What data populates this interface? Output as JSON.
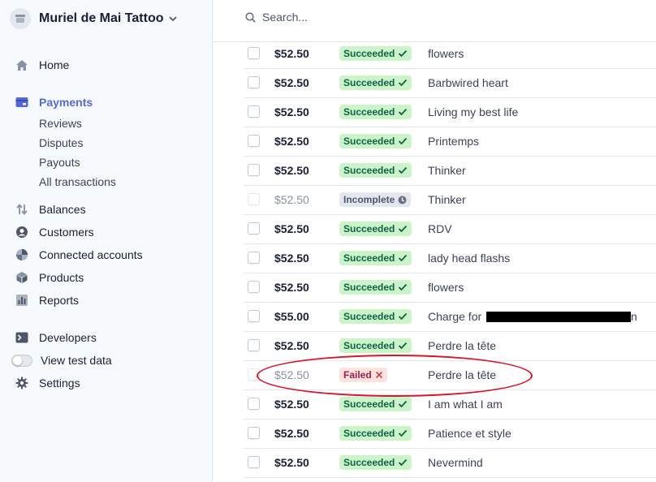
{
  "account": {
    "name": "Muriel de Mai Tattoo"
  },
  "sidebar": {
    "items": [
      {
        "key": "home",
        "label": "Home",
        "icon": "home-icon"
      },
      {
        "key": "payments",
        "label": "Payments",
        "icon": "payments-icon",
        "active": true
      },
      {
        "key": "balances",
        "label": "Balances",
        "icon": "balances-icon"
      },
      {
        "key": "customers",
        "label": "Customers",
        "icon": "customers-icon"
      },
      {
        "key": "connected",
        "label": "Connected accounts",
        "icon": "connected-accounts-icon"
      },
      {
        "key": "products",
        "label": "Products",
        "icon": "products-icon"
      },
      {
        "key": "reports",
        "label": "Reports",
        "icon": "reports-icon"
      },
      {
        "key": "developers",
        "label": "Developers",
        "icon": "terminal-icon"
      },
      {
        "key": "testdata",
        "label": "View test data",
        "icon": "toggle"
      },
      {
        "key": "settings",
        "label": "Settings",
        "icon": "gear-icon"
      }
    ],
    "payments_sub": [
      "Reviews",
      "Disputes",
      "Payouts",
      "All transactions"
    ]
  },
  "search": {
    "placeholder": "Search..."
  },
  "payments": [
    {
      "amount": "$52.50",
      "status": "Succeeded",
      "description": "flowers"
    },
    {
      "amount": "$52.50",
      "status": "Succeeded",
      "description": "Barbwired heart"
    },
    {
      "amount": "$52.50",
      "status": "Succeeded",
      "description": "Living my best life"
    },
    {
      "amount": "$52.50",
      "status": "Succeeded",
      "description": "Printemps"
    },
    {
      "amount": "$52.50",
      "status": "Succeeded",
      "description": "Thinker"
    },
    {
      "amount": "$52.50",
      "status": "Incomplete",
      "description": "Thinker"
    },
    {
      "amount": "$52.50",
      "status": "Succeeded",
      "description": "RDV"
    },
    {
      "amount": "$52.50",
      "status": "Succeeded",
      "description": "lady head flashs"
    },
    {
      "amount": "$52.50",
      "status": "Succeeded",
      "description": "flowers"
    },
    {
      "amount": "$55.00",
      "status": "Succeeded",
      "description": "Charge for",
      "redacted": true,
      "suffix": "n"
    },
    {
      "amount": "$52.50",
      "status": "Succeeded",
      "description": "Perdre la tête"
    },
    {
      "amount": "$52.50",
      "status": "Failed",
      "description": "Perdre la tête"
    },
    {
      "amount": "$52.50",
      "status": "Succeeded",
      "description": "I am what I am"
    },
    {
      "amount": "$52.50",
      "status": "Succeeded",
      "description": "Patience et style"
    },
    {
      "amount": "$52.50",
      "status": "Succeeded",
      "description": "Nevermind"
    }
  ],
  "colors": {
    "accent": "#5469d4",
    "succeeded_bg": "#cbf4c9",
    "failed_bg": "#fde2dd",
    "annotation": "#d8152a"
  }
}
